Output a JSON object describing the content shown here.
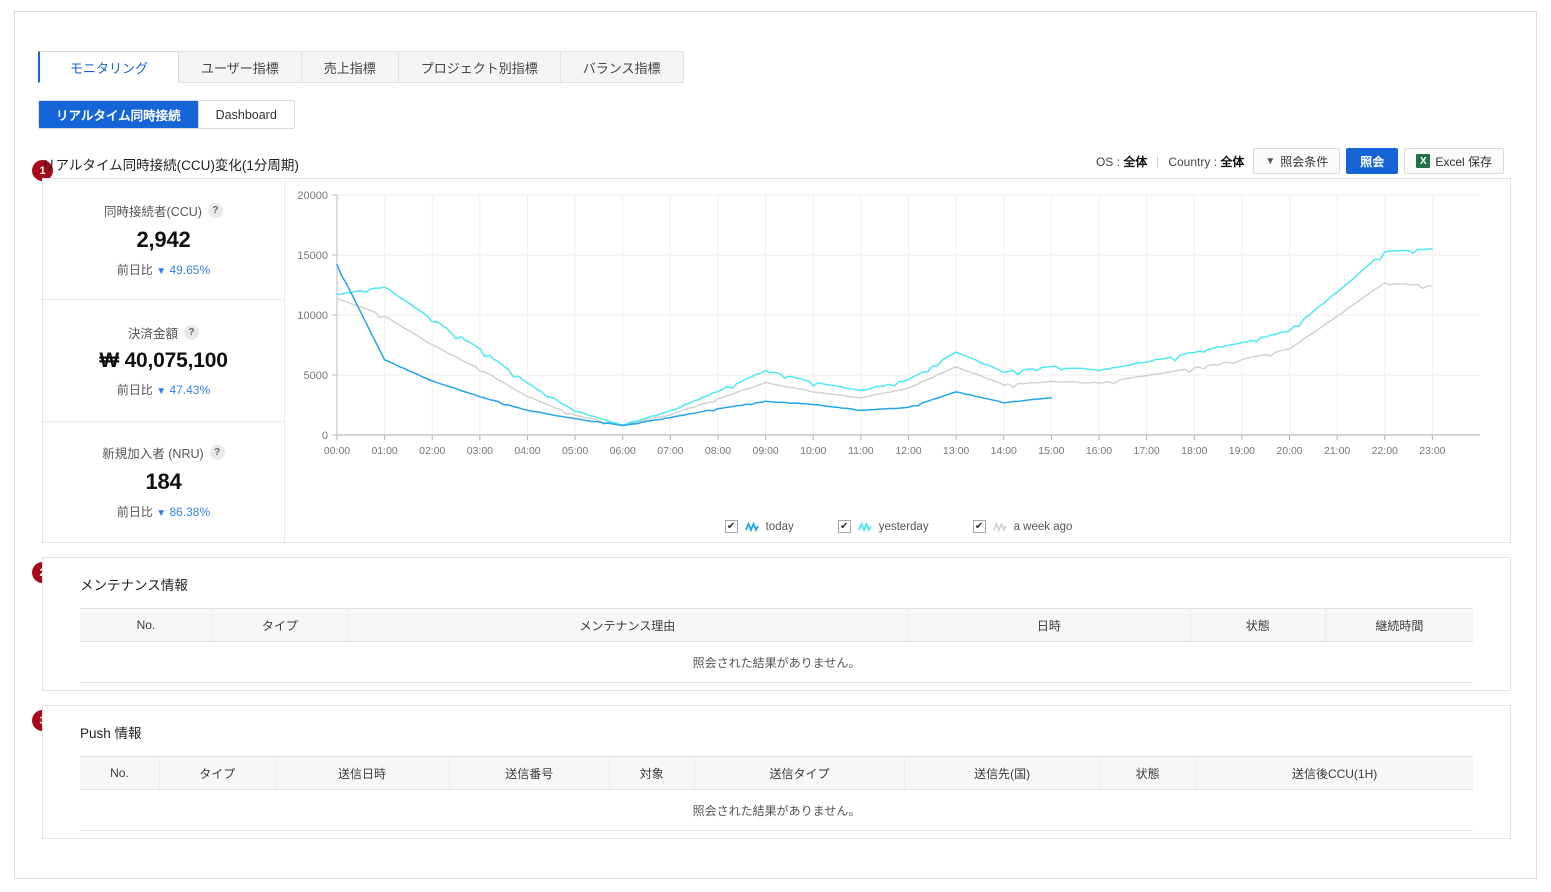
{
  "tabs": [
    {
      "label": "モニタリング",
      "active": true
    },
    {
      "label": "ユーザー指標",
      "active": false
    },
    {
      "label": "売上指標",
      "active": false
    },
    {
      "label": "プロジェクト別指標",
      "active": false
    },
    {
      "label": "バランス指標",
      "active": false
    }
  ],
  "subtabs": [
    {
      "label": "リアルタイム同時接続",
      "active": true
    },
    {
      "label": "Dashboard",
      "active": false
    }
  ],
  "section1": {
    "badge": "1",
    "title": "リアルタイム同時接続(CCU)変化(1分周期)",
    "filters": {
      "os_label": "OS :",
      "os_value": "全体",
      "country_label": "Country :",
      "country_value": "全体"
    },
    "buttons": {
      "filter": "照会条件",
      "search": "照会",
      "excel": "Excel 保存",
      "excel_icon": "X",
      "funnel_icon": "▼"
    },
    "stats": [
      {
        "label": "同時接続者(CCU)",
        "help": "?",
        "value": "2,942",
        "delta_label": "前日比",
        "delta_arrow": "▼",
        "delta_pct": "49.65%"
      },
      {
        "label": "決済金額",
        "help": "?",
        "value": "₩ 40,075,100",
        "delta_label": "前日比",
        "delta_arrow": "▼",
        "delta_pct": "47.43%"
      },
      {
        "label": "新規加入者 (NRU)",
        "help": "?",
        "value": "184",
        "delta_label": "前日比",
        "delta_arrow": "▼",
        "delta_pct": "86.38%"
      }
    ]
  },
  "chart_data": {
    "type": "line",
    "title": "リアルタイム同時接続(CCU)変化(1分周期)",
    "xlabel": "",
    "ylabel": "",
    "ylim": [
      0,
      20000
    ],
    "yticks": [
      0,
      5000,
      10000,
      15000,
      20000
    ],
    "ytick_labels": [
      "0",
      "5000",
      "10000",
      "15000",
      "20000"
    ],
    "grid": true,
    "legend_position": "bottom",
    "x": [
      "00:00",
      "01:00",
      "02:00",
      "03:00",
      "04:00",
      "05:00",
      "06:00",
      "07:00",
      "08:00",
      "09:00",
      "10:00",
      "11:00",
      "12:00",
      "13:00",
      "14:00",
      "15:00",
      "16:00",
      "17:00",
      "18:00",
      "19:00",
      "20:00",
      "21:00",
      "22:00",
      "23:00"
    ],
    "series": [
      {
        "name": "today",
        "color": "#24a5e8",
        "checked": true,
        "values": [
          14200,
          6250,
          4500,
          3200,
          2050,
          1350,
          800,
          1450,
          2200,
          2800,
          2550,
          2050,
          2300,
          3600,
          2700,
          3100,
          null,
          null,
          null,
          null,
          null,
          null,
          null,
          null
        ]
      },
      {
        "name": "yesterday",
        "color": "#4fe8f0",
        "checked": true,
        "values": [
          11700,
          12350,
          9650,
          7200,
          4300,
          2000,
          850,
          2000,
          3650,
          5350,
          4400,
          3700,
          4600,
          6900,
          5250,
          5700,
          5400,
          6100,
          6900,
          7700,
          8700,
          11900,
          15300,
          15500
        ]
      },
      {
        "name": "a week ago",
        "color": "#d2d2d2",
        "checked": true,
        "values": [
          11400,
          9900,
          7500,
          5500,
          3200,
          1650,
          800,
          1700,
          3000,
          4350,
          3600,
          3100,
          3900,
          5700,
          4200,
          4450,
          4350,
          4950,
          5600,
          6300,
          7150,
          9900,
          12700,
          12400
        ]
      }
    ]
  },
  "section2": {
    "badge": "2",
    "title": "メンテナンス情報",
    "columns": [
      "No.",
      "タイプ",
      "メンテナンス理由",
      "日時",
      "状態",
      "継続時間"
    ],
    "empty_text": "照会された結果がありません。"
  },
  "section3": {
    "badge": "3",
    "title": "Push 情報",
    "columns": [
      "No.",
      "タイプ",
      "送信日時",
      "送信番号",
      "対象",
      "送信タイプ",
      "送信先(国)",
      "状態",
      "送信後CCU(1H)"
    ],
    "empty_text": "照会された結果がありません。"
  }
}
